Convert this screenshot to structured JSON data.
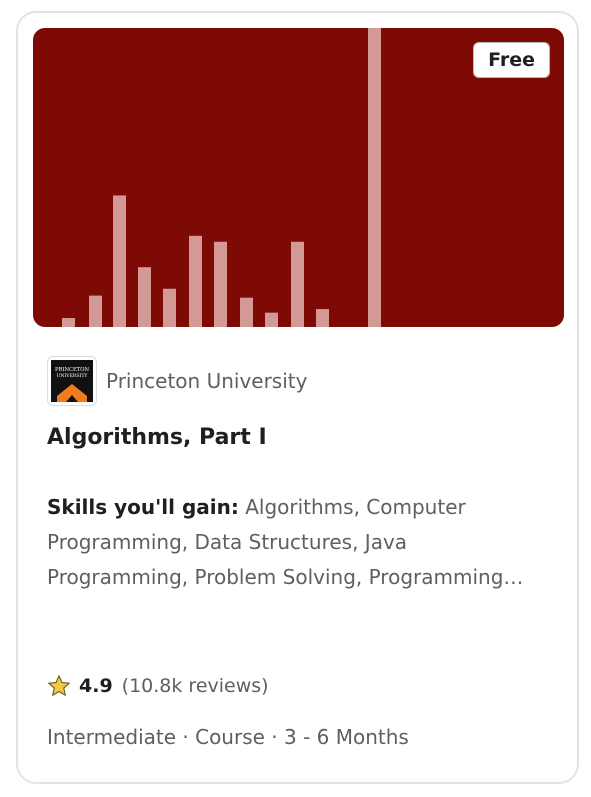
{
  "card": {
    "badge": "Free",
    "hero_background": "#7e0a05",
    "hero_bar_color": "#d39a95",
    "partner": {
      "logo_text_line1": "PRINCETON",
      "logo_text_line2": "UNIVERSITY",
      "logo_icon": "princeton-logo",
      "name": "Princeton University"
    },
    "title": "Algorithms, Part I",
    "skills_label": "Skills you'll gain:",
    "skills_text": " Algorithms, Computer Programming, Data Structures, Java Programming, Problem Solving, Programming Principles",
    "rating": {
      "icon": "star-icon",
      "score": "4.9",
      "reviews": "(10.8k reviews)"
    },
    "meta": "Intermediate · Course · 3 - 6 Months"
  },
  "hero_bars": [
    0.03,
    0.105,
    0.44,
    0.2,
    0.128,
    0.305,
    0.285,
    0.098,
    0.048,
    0.285,
    0.06,
    1.0
  ]
}
